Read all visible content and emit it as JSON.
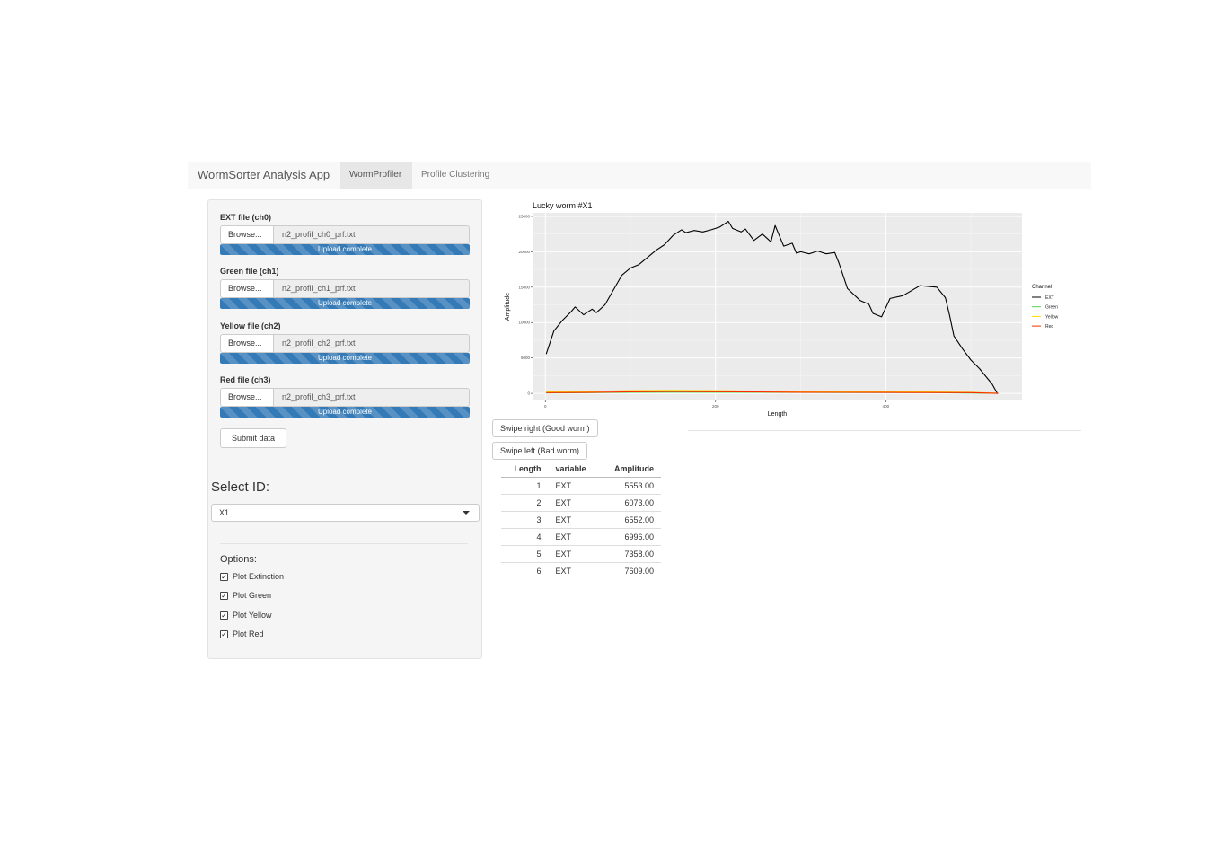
{
  "navbar": {
    "brand": "WormSorter Analysis App",
    "tabs": [
      {
        "label": "WormProfiler",
        "active": true
      },
      {
        "label": "Profile Clustering",
        "active": false
      }
    ]
  },
  "sidebar": {
    "files": [
      {
        "label": "EXT file (ch0)",
        "browse": "Browse...",
        "filename": "n2_profil_ch0_prf.txt",
        "status": "Upload complete"
      },
      {
        "label": "Green file (ch1)",
        "browse": "Browse...",
        "filename": "n2_profil_ch1_prf.txt",
        "status": "Upload complete"
      },
      {
        "label": "Yellow file (ch2)",
        "browse": "Browse...",
        "filename": "n2_profil_ch2_prf.txt",
        "status": "Upload complete"
      },
      {
        "label": "Red file (ch3)",
        "browse": "Browse...",
        "filename": "n2_profil_ch3_prf.txt",
        "status": "Upload complete"
      }
    ],
    "submit_label": "Submit data",
    "select_label": "Select ID:",
    "select_value": "X1",
    "options_label": "Options:",
    "options": [
      {
        "label": "Plot Extinction",
        "checked": true
      },
      {
        "label": "Plot Green",
        "checked": true
      },
      {
        "label": "Plot Yellow",
        "checked": true
      },
      {
        "label": "Plot Red",
        "checked": true
      }
    ]
  },
  "main": {
    "swipe_right_label": "Swipe right (Good worm)",
    "swipe_left_label": "Swipe left (Bad worm)",
    "table": {
      "columns": [
        "Length",
        "variable",
        "Amplitude"
      ],
      "rows": [
        [
          "1",
          "EXT",
          "5553.00"
        ],
        [
          "2",
          "EXT",
          "6073.00"
        ],
        [
          "3",
          "EXT",
          "6552.00"
        ],
        [
          "4",
          "EXT",
          "6996.00"
        ],
        [
          "5",
          "EXT",
          "7358.00"
        ],
        [
          "6",
          "EXT",
          "7609.00"
        ]
      ]
    }
  },
  "chart_data": {
    "type": "line",
    "title": "Lucky worm #X1",
    "xlabel": "Length",
    "ylabel": "Amplitude",
    "xlim": [
      -15,
      560
    ],
    "ylim": [
      -1000,
      25500
    ],
    "xticks": [
      0,
      200,
      400
    ],
    "yticks": [
      0,
      5000,
      10000,
      15000,
      20000,
      25000
    ],
    "legend_title": "Channel",
    "legend_position": "right",
    "background": "#ebebeb",
    "grid": true,
    "series": [
      {
        "name": "EXT",
        "color": "#000000",
        "x": [
          1,
          10,
          20,
          30,
          35,
          45,
          55,
          60,
          70,
          80,
          90,
          100,
          110,
          120,
          130,
          140,
          150,
          160,
          165,
          175,
          185,
          195,
          205,
          215,
          220,
          230,
          235,
          245,
          255,
          265,
          270,
          280,
          290,
          295,
          300,
          310,
          320,
          330,
          340,
          345,
          355,
          370,
          380,
          385,
          395,
          405,
          420,
          440,
          460,
          470,
          475,
          480,
          490,
          500,
          510,
          525,
          531,
          532
        ],
        "y": [
          5553,
          8800,
          10300,
          11500,
          12200,
          11100,
          11900,
          11400,
          12500,
          14600,
          16700,
          17700,
          18200,
          19200,
          20200,
          21000,
          22300,
          23100,
          22700,
          23000,
          22800,
          23100,
          23500,
          24300,
          23300,
          22800,
          23200,
          21600,
          22500,
          21400,
          23700,
          20800,
          21200,
          19800,
          20000,
          19700,
          20100,
          19700,
          19900,
          18400,
          14800,
          13100,
          12600,
          11300,
          10800,
          13400,
          13800,
          15200,
          15000,
          13500,
          11000,
          8100,
          6300,
          4700,
          3500,
          1300,
          0,
          0
        ]
      },
      {
        "name": "Green",
        "color": "#4cd64c",
        "x": [
          1,
          100,
          150,
          250,
          350,
          450,
          532
        ],
        "y": [
          60,
          150,
          170,
          150,
          120,
          110,
          0
        ]
      },
      {
        "name": "Yellow",
        "color": "#ffd700",
        "x": [
          1,
          50,
          100,
          150,
          200,
          250,
          300,
          350,
          400,
          450,
          500,
          532
        ],
        "y": [
          200,
          250,
          380,
          420,
          380,
          300,
          260,
          220,
          200,
          190,
          160,
          0
        ]
      },
      {
        "name": "Red",
        "color": "#ff2a00",
        "x": [
          1,
          50,
          100,
          150,
          200,
          250,
          300,
          350,
          400,
          450,
          500,
          532
        ],
        "y": [
          100,
          130,
          220,
          260,
          230,
          190,
          160,
          140,
          130,
          120,
          100,
          0
        ]
      }
    ]
  }
}
